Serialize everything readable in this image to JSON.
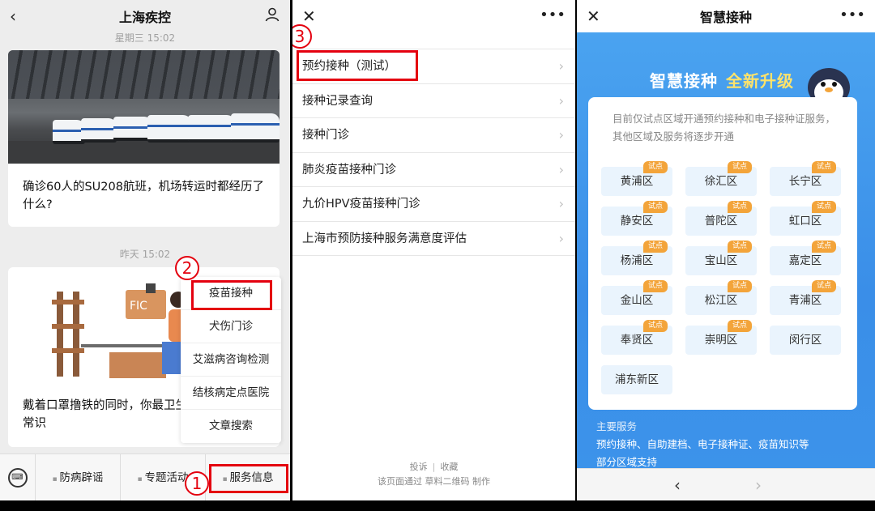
{
  "panel1": {
    "title": "上海疾控",
    "back_icon": "back-chevron-icon",
    "profile_icon": "person-icon",
    "timestamp_top": "星期三 15:02",
    "article1_title": "确诊60人的SU208航班，机场转运时都经历了什么?",
    "timestamp2": "昨天 15:02",
    "article2_title": "戴着口罩撸铁的同时，你最卫生常识",
    "popup_items": [
      "疫苗接种",
      "犬伤门诊",
      "艾滋病咨询检测",
      "结核病定点医院",
      "文章搜索"
    ],
    "tabs": [
      "防病辟谣",
      "专题活动",
      "服务信息"
    ],
    "illus_sign": "FIC",
    "badges": {
      "b1": "1",
      "b2": "2"
    }
  },
  "panel2": {
    "close_icon": "close-icon",
    "more_icon": "more-icon",
    "badge": "3",
    "menu": [
      "预约接种（测试）",
      "接种记录查询",
      "接种门诊",
      "肺炎疫苗接种门诊",
      "九价HPV疫苗接种门诊",
      "上海市预防接种服务满意度评估"
    ],
    "footer_links": [
      "投诉",
      "收藏"
    ],
    "footer_note": "该页面通过 草料二维码 制作"
  },
  "panel3": {
    "title": "智慧接种",
    "headline_a": "智慧接种",
    "headline_b": "全新升级",
    "notice": "目前仅试点区域开通预约接种和电子接种证服务，其他区域及服务将逐步开通",
    "districts": [
      {
        "name": "黄浦区",
        "tag": "试点"
      },
      {
        "name": "徐汇区",
        "tag": "试点"
      },
      {
        "name": "长宁区",
        "tag": "试点"
      },
      {
        "name": "静安区",
        "tag": "试点"
      },
      {
        "name": "普陀区",
        "tag": "试点"
      },
      {
        "name": "虹口区",
        "tag": "试点"
      },
      {
        "name": "杨浦区",
        "tag": "试点"
      },
      {
        "name": "宝山区",
        "tag": "试点"
      },
      {
        "name": "嘉定区",
        "tag": "试点"
      },
      {
        "name": "金山区",
        "tag": "试点"
      },
      {
        "name": "松江区",
        "tag": "试点"
      },
      {
        "name": "青浦区",
        "tag": "试点"
      },
      {
        "name": "奉贤区",
        "tag": "试点"
      },
      {
        "name": "崇明区",
        "tag": "试点"
      },
      {
        "name": "闵行区",
        "tag": ""
      },
      {
        "name": "浦东新区",
        "tag": ""
      }
    ],
    "services_heading": "主要服务",
    "services_list": "预约接种、自助建档、电子接种证、疫苗知识等",
    "services_more": "部分区域支持",
    "colors": {
      "accent_blue": "#3a8ee8",
      "tag_orange": "#f3a43a",
      "highlight_red": "#e4000f"
    }
  }
}
